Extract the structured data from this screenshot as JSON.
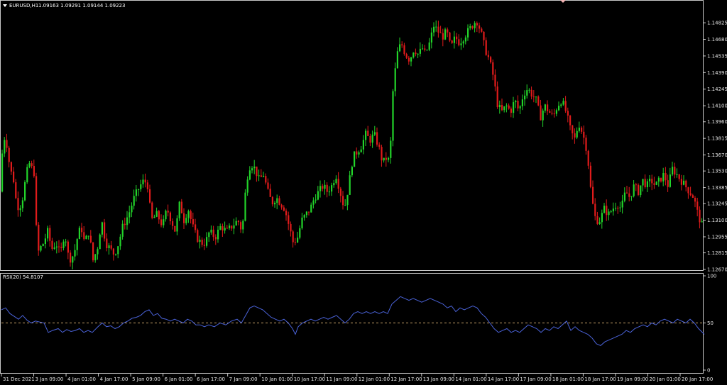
{
  "header": {
    "title": "EURUSD,H1",
    "ohlc": "1.09163 1.09291 1.09144 1.09223",
    "indicator_label": "RSI(20) 54.8107"
  },
  "colors": {
    "background": "#000000",
    "axis_frame": "#c8c8c8",
    "bull": "#22d42a",
    "bear": "#e01b1b",
    "rsi_line": "#4a62d8",
    "rsi_level": "#c8a26a"
  },
  "chart_data": [
    {
      "type": "candlestick",
      "symbol": "EURUSD,H1",
      "ylim": [
        1.1267,
        1.149
      ],
      "y_ticks": [
        "1.14825",
        "1.14680",
        "1.14535",
        "1.14390",
        "1.14245",
        "1.14100",
        "1.13960",
        "1.13815",
        "1.13670",
        "1.13530",
        "1.13385",
        "1.13245",
        "1.13100",
        "1.12955",
        "1.12815",
        "1.12670"
      ],
      "x_ticks": [
        "31 Dec 2021",
        "3 Jan 09:00",
        "4 Jan 01:00",
        "4 Jan 17:00",
        "5 Jan 09:00",
        "6 Jan 01:00",
        "6 Jan 17:00",
        "7 Jan 09:00",
        "10 Jan 01:00",
        "10 Jan 17:00",
        "11 Jan 09:00",
        "12 Jan 01:00",
        "12 Jan 17:00",
        "13 Jan 09:00",
        "14 Jan 01:00",
        "14 Jan 17:00",
        "17 Jan 09:00",
        "18 Jan 01:00",
        "18 Jan 17:00",
        "19 Jan 09:00",
        "20 Jan 01:00",
        "20 Jan 17:00"
      ],
      "close_path": [
        [
          0,
          1.1335
        ],
        [
          3,
          1.1385
        ],
        [
          8,
          1.1378
        ],
        [
          13,
          1.1355
        ],
        [
          18,
          1.1345
        ],
        [
          22,
          1.1325
        ],
        [
          26,
          1.132
        ],
        [
          31,
          1.133
        ],
        [
          36,
          1.135
        ],
        [
          40,
          1.136
        ],
        [
          44,
          1.1355
        ],
        [
          48,
          1.135
        ],
        [
          51,
          1.128
        ],
        [
          55,
          1.1285
        ],
        [
          60,
          1.129
        ],
        [
          66,
          1.13
        ],
        [
          72,
          1.1285
        ],
        [
          78,
          1.129
        ],
        [
          84,
          1.128
        ],
        [
          90,
          1.13
        ],
        [
          96,
          1.1275
        ],
        [
          103,
          1.128
        ],
        [
          108,
          1.1295
        ],
        [
          113,
          1.1305
        ],
        [
          118,
          1.129
        ],
        [
          124,
          1.13
        ],
        [
          130,
          1.1275
        ],
        [
          136,
          1.1285
        ],
        [
          142,
          1.131
        ],
        [
          148,
          1.129
        ],
        [
          154,
          1.1285
        ],
        [
          160,
          1.128
        ],
        [
          166,
          1.129
        ],
        [
          172,
          1.1305
        ],
        [
          180,
          1.1315
        ],
        [
          188,
          1.133
        ],
        [
          196,
          1.134
        ],
        [
          202,
          1.1345
        ],
        [
          207,
          1.134
        ],
        [
          212,
          1.131
        ],
        [
          220,
          1.1315
        ],
        [
          228,
          1.1305
        ],
        [
          234,
          1.132
        ],
        [
          240,
          1.131
        ],
        [
          246,
          1.13
        ],
        [
          252,
          1.1325
        ],
        [
          258,
          1.131
        ],
        [
          264,
          1.132
        ],
        [
          270,
          1.1305
        ],
        [
          276,
          1.1295
        ],
        [
          282,
          1.129
        ],
        [
          288,
          1.129
        ],
        [
          294,
          1.13
        ],
        [
          302,
          1.1295
        ],
        [
          310,
          1.1305
        ],
        [
          318,
          1.13
        ],
        [
          326,
          1.1305
        ],
        [
          334,
          1.131
        ],
        [
          340,
          1.13
        ],
        [
          346,
          1.1345
        ],
        [
          352,
          1.136
        ],
        [
          358,
          1.1355
        ],
        [
          364,
          1.1345
        ],
        [
          370,
          1.135
        ],
        [
          376,
          1.1335
        ],
        [
          382,
          1.1325
        ],
        [
          388,
          1.133
        ],
        [
          394,
          1.1325
        ],
        [
          400,
          1.132
        ],
        [
          406,
          1.1305
        ],
        [
          412,
          1.129
        ],
        [
          418,
          1.1295
        ],
        [
          424,
          1.131
        ],
        [
          430,
          1.1315
        ],
        [
          436,
          1.132
        ],
        [
          442,
          1.133
        ],
        [
          448,
          1.1335
        ],
        [
          454,
          1.134
        ],
        [
          460,
          1.1335
        ],
        [
          466,
          1.134
        ],
        [
          472,
          1.135
        ],
        [
          478,
          1.1335
        ],
        [
          484,
          1.132
        ],
        [
          490,
          1.134
        ],
        [
          496,
          1.1365
        ],
        [
          502,
          1.137
        ],
        [
          508,
          1.1375
        ],
        [
          514,
          1.1385
        ],
        [
          520,
          1.138
        ],
        [
          526,
          1.1385
        ],
        [
          532,
          1.1375
        ],
        [
          538,
          1.136
        ],
        [
          544,
          1.1365
        ],
        [
          548,
          1.136
        ],
        [
          552,
          1.142
        ],
        [
          558,
          1.1455
        ],
        [
          564,
          1.1465
        ],
        [
          570,
          1.1455
        ],
        [
          576,
          1.145
        ],
        [
          582,
          1.146
        ],
        [
          588,
          1.1455
        ],
        [
          594,
          1.146
        ],
        [
          598,
          1.1455
        ],
        [
          604,
          1.1465
        ],
        [
          610,
          1.148
        ],
        [
          616,
          1.1475
        ],
        [
          622,
          1.147
        ],
        [
          628,
          1.1475
        ],
        [
          634,
          1.146
        ],
        [
          640,
          1.147
        ],
        [
          646,
          1.1465
        ],
        [
          652,
          1.147
        ],
        [
          658,
          1.1475
        ],
        [
          664,
          1.148
        ],
        [
          670,
          1.1485
        ],
        [
          676,
          1.1475
        ],
        [
          682,
          1.146
        ],
        [
          688,
          1.145
        ],
        [
          694,
          1.1435
        ],
        [
          700,
          1.141
        ],
        [
          706,
          1.1405
        ],
        [
          712,
          1.141
        ],
        [
          718,
          1.1405
        ],
        [
          724,
          1.1415
        ],
        [
          730,
          1.1405
        ],
        [
          736,
          1.142
        ],
        [
          742,
          1.1425
        ],
        [
          748,
          1.142
        ],
        [
          754,
          1.1415
        ],
        [
          760,
          1.14
        ],
        [
          766,
          1.141
        ],
        [
          772,
          1.1405
        ],
        [
          778,
          1.14
        ],
        [
          784,
          1.141
        ],
        [
          790,
          1.1415
        ],
        [
          796,
          1.1405
        ],
        [
          802,
          1.139
        ],
        [
          808,
          1.138
        ],
        [
          814,
          1.1395
        ],
        [
          820,
          1.1385
        ],
        [
          826,
          1.137
        ],
        [
          832,
          1.133
        ],
        [
          838,
          1.131
        ],
        [
          844,
          1.131
        ],
        [
          850,
          1.132
        ],
        [
          856,
          1.1315
        ],
        [
          862,
          1.132
        ],
        [
          868,
          1.1325
        ],
        [
          874,
          1.132
        ],
        [
          880,
          1.1335
        ],
        [
          886,
          1.133
        ],
        [
          892,
          1.134
        ],
        [
          898,
          1.1335
        ],
        [
          904,
          1.1345
        ],
        [
          910,
          1.134
        ],
        [
          916,
          1.1345
        ],
        [
          922,
          1.134
        ],
        [
          928,
          1.1345
        ],
        [
          934,
          1.135
        ],
        [
          940,
          1.134
        ],
        [
          946,
          1.1355
        ],
        [
          952,
          1.135
        ],
        [
          958,
          1.1345
        ],
        [
          964,
          1.134
        ],
        [
          970,
          1.1335
        ],
        [
          976,
          1.133
        ],
        [
          982,
          1.1315
        ],
        [
          988,
          1.1305
        ]
      ]
    },
    {
      "type": "line",
      "series": [
        {
          "name": "RSI(20)",
          "last": 54.8107
        }
      ],
      "ylim": [
        0,
        100
      ],
      "level": 50,
      "y_ticks": [
        "100",
        "50",
        "0"
      ],
      "values_path": [
        [
          0,
          64
        ],
        [
          6,
          66
        ],
        [
          12,
          60
        ],
        [
          18,
          57
        ],
        [
          24,
          54
        ],
        [
          30,
          58
        ],
        [
          36,
          53
        ],
        [
          42,
          50
        ],
        [
          48,
          52
        ],
        [
          54,
          51
        ],
        [
          60,
          50
        ],
        [
          66,
          40
        ],
        [
          72,
          42
        ],
        [
          80,
          44
        ],
        [
          86,
          40
        ],
        [
          92,
          43
        ],
        [
          98,
          41
        ],
        [
          104,
          42
        ],
        [
          110,
          44
        ],
        [
          116,
          40
        ],
        [
          122,
          42
        ],
        [
          128,
          40
        ],
        [
          136,
          46
        ],
        [
          142,
          50
        ],
        [
          148,
          46
        ],
        [
          154,
          47
        ],
        [
          160,
          44
        ],
        [
          166,
          46
        ],
        [
          172,
          50
        ],
        [
          178,
          52
        ],
        [
          184,
          55
        ],
        [
          190,
          56
        ],
        [
          196,
          58
        ],
        [
          202,
          62
        ],
        [
          208,
          64
        ],
        [
          214,
          58
        ],
        [
          220,
          60
        ],
        [
          226,
          55
        ],
        [
          232,
          54
        ],
        [
          238,
          52
        ],
        [
          244,
          54
        ],
        [
          250,
          52
        ],
        [
          256,
          50
        ],
        [
          262,
          54
        ],
        [
          268,
          52
        ],
        [
          274,
          48
        ],
        [
          280,
          48
        ],
        [
          286,
          46
        ],
        [
          292,
          48
        ],
        [
          300,
          46
        ],
        [
          308,
          50
        ],
        [
          316,
          48
        ],
        [
          324,
          52
        ],
        [
          332,
          54
        ],
        [
          338,
          50
        ],
        [
          344,
          58
        ],
        [
          350,
          66
        ],
        [
          356,
          68
        ],
        [
          362,
          66
        ],
        [
          368,
          64
        ],
        [
          374,
          60
        ],
        [
          380,
          56
        ],
        [
          386,
          54
        ],
        [
          392,
          52
        ],
        [
          398,
          54
        ],
        [
          404,
          50
        ],
        [
          410,
          44
        ],
        [
          414,
          38
        ],
        [
          418,
          46
        ],
        [
          424,
          50
        ],
        [
          430,
          52
        ],
        [
          436,
          54
        ],
        [
          442,
          52
        ],
        [
          448,
          54
        ],
        [
          454,
          56
        ],
        [
          460,
          54
        ],
        [
          466,
          56
        ],
        [
          472,
          58
        ],
        [
          478,
          54
        ],
        [
          484,
          50
        ],
        [
          490,
          54
        ],
        [
          496,
          60
        ],
        [
          502,
          62
        ],
        [
          508,
          60
        ],
        [
          514,
          62
        ],
        [
          520,
          60
        ],
        [
          526,
          62
        ],
        [
          532,
          60
        ],
        [
          538,
          62
        ],
        [
          544,
          60
        ],
        [
          550,
          70
        ],
        [
          556,
          74
        ],
        [
          562,
          78
        ],
        [
          568,
          76
        ],
        [
          574,
          74
        ],
        [
          580,
          76
        ],
        [
          586,
          74
        ],
        [
          592,
          72
        ],
        [
          598,
          74
        ],
        [
          604,
          76
        ],
        [
          610,
          74
        ],
        [
          616,
          72
        ],
        [
          622,
          70
        ],
        [
          628,
          66
        ],
        [
          634,
          68
        ],
        [
          640,
          62
        ],
        [
          646,
          66
        ],
        [
          652,
          64
        ],
        [
          658,
          66
        ],
        [
          664,
          68
        ],
        [
          670,
          66
        ],
        [
          676,
          60
        ],
        [
          682,
          56
        ],
        [
          688,
          50
        ],
        [
          694,
          44
        ],
        [
          700,
          40
        ],
        [
          706,
          42
        ],
        [
          712,
          44
        ],
        [
          718,
          40
        ],
        [
          724,
          42
        ],
        [
          730,
          40
        ],
        [
          736,
          44
        ],
        [
          742,
          48
        ],
        [
          748,
          46
        ],
        [
          754,
          44
        ],
        [
          760,
          40
        ],
        [
          766,
          44
        ],
        [
          772,
          42
        ],
        [
          778,
          46
        ],
        [
          784,
          44
        ],
        [
          790,
          48
        ],
        [
          796,
          52
        ],
        [
          802,
          42
        ],
        [
          808,
          46
        ],
        [
          814,
          42
        ],
        [
          820,
          40
        ],
        [
          826,
          38
        ],
        [
          832,
          34
        ],
        [
          838,
          28
        ],
        [
          844,
          26
        ],
        [
          850,
          30
        ],
        [
          856,
          32
        ],
        [
          862,
          34
        ],
        [
          868,
          36
        ],
        [
          874,
          38
        ],
        [
          880,
          42
        ],
        [
          886,
          40
        ],
        [
          892,
          44
        ],
        [
          898,
          46
        ],
        [
          904,
          48
        ],
        [
          910,
          46
        ],
        [
          916,
          50
        ],
        [
          922,
          48
        ],
        [
          928,
          52
        ],
        [
          934,
          54
        ],
        [
          940,
          52
        ],
        [
          946,
          50
        ],
        [
          952,
          54
        ],
        [
          958,
          52
        ],
        [
          964,
          50
        ],
        [
          970,
          54
        ],
        [
          976,
          50
        ],
        [
          982,
          44
        ],
        [
          990,
          38
        ]
      ]
    }
  ]
}
